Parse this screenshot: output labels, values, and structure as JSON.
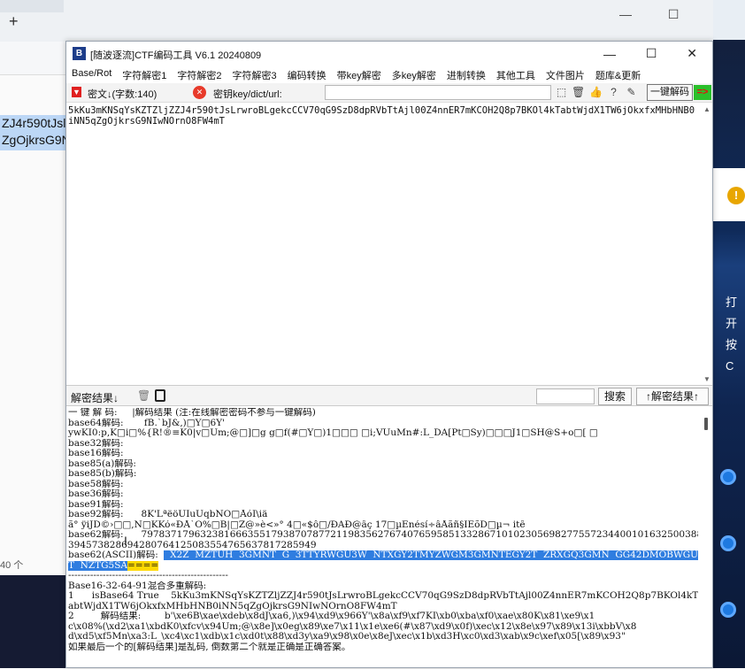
{
  "browser": {
    "new_tab_icon": "+",
    "selected_text_line1": "ZJ4r590tJsl",
    "selected_text_line2": "ZgOjkrsG9N",
    "count_text": "40 个",
    "controls": [
      "—",
      "☐",
      "✕"
    ]
  },
  "side_panel": {
    "warn_icon": "!",
    "text_line1": "打开",
    "text_line2": "按C"
  },
  "window": {
    "icon": "B",
    "title": "[随波逐流]CTF编码工具 V6.1 20240809",
    "minimize": "—",
    "maximize": "☐",
    "close": "✕"
  },
  "menu": [
    "Base/Rot",
    "字符解密1",
    "字符解密2",
    "字符解密3",
    "编码转换",
    "带key解密",
    "多key解密",
    "进制转换",
    "其他工具",
    "文件图片",
    "题库&更新"
  ],
  "toolbar": {
    "ciphertext_label": "密文↓(字数:140)",
    "key_label": "密钥key/dict/url:",
    "key_value": "",
    "one_key_button": "一键解码",
    "go_button": "=>"
  },
  "input": {
    "text": "5kKu3mKNSqYsKZTZljZZJ4r590tJsLrwroBLgekcCCV70qG9SzD8dpRVbTtAjl00Z4nnER7mKCOH2Q8p7BKOl4kTabtWjdX1TW6jOkxfxMHbHNB0iNN5qZgOjkrsG9NIwNOrnO8FW4mT"
  },
  "result_bar": {
    "label": "解密结果↓",
    "search_value": "",
    "search_button": "搜索",
    "export_button": "↑解密结果↑"
  },
  "output_lines": [
    {
      "t": "一 键 解 码:     |解码结果 (注:在线解密密码不参与一键解码)"
    },
    {
      "t": "base64解码:       fB.`bJ&,)□Y□6Y'"
    },
    {
      "t": "ywKI0:p,K□i□%{R!®≡K0|v□Um;@□]□g g□f(#□Y□)1□□□ □i;VUuMn#:L_DA[Pt□Sy)□□□J1□SH@S+o□[ □"
    },
    {
      "t": "base32解码:"
    },
    {
      "t": "base16解码:"
    },
    {
      "t": "base85(a)解码:"
    },
    {
      "t": "base85(b)解码:"
    },
    {
      "t": "base58解码:"
    },
    {
      "t": "base36解码:"
    },
    {
      "t": "base91解码:"
    },
    {
      "t": "base92解码:      8K'LªëöÛIuÜqbNÖ□ÅóÎ\\iä"
    },
    {
      "t": "ã° ÿiJD©›□□,Ñ□KKó«ÐÅ`Ö%□B|□Z@»è<»° 4□«$ô□/ÐAÐ@âç 17□µÉnésí÷âÅãñ§ÎEõD□µ¬ itê"
    },
    {
      "t": "base62解码:      7978371796323816663551793870787721198356276740765958513328671010230569827755723440010163250038824848225956290888739935206503778263002917938893877040698882076598493551370597359283761861436757516359422213719169"
    },
    {
      "t": "394573828694280764125083554765637817285949"
    },
    {
      "t": "base62(ASCII)解码:  ",
      "h": "  X2Z  MZTUH  3GMNT  G  3TTYRWGU3W  NTXGY2TMYZWGM3GMNTEGY2T  ZRXGQ3GMN  GG42DMOBWGU2WMNRWGY4TMZJWGEZ"
    },
    {
      "t": "",
      "h": "T  NZTG5SA",
      "y": "===="
    },
    {
      "t": "---------------------------------------------------"
    },
    {
      "t": "Base16-32-64-91混合多重解码:"
    },
    {
      "t": "1      isBase64 True    5kKu3mKNSqYsKZTZljZZJ4r590tJsLrwroBLgekcCCV70qG9SzD8dpRVbTtAjl00Z4nnER7mKCOH2Q8p7BKOl4kT"
    },
    {
      "t": "abtWjdX1TW6jOkxfxMHbHNB0iNN5qZgOjkrsG9NIwNOrnO8FW4mT"
    },
    {
      "t": "2         解码结果:        b'\\xe6B\\xae\\xdeb\\x8dJ\\xa6,)\\x94\\xd9\\x966Y'\\x8a\\xf9\\xf7KI\\xb0\\xba\\xf0\\xae\\x80K\\x81\\xe9\\x1"
    },
    {
      "t": "c\\x08%(\\xd2\\xa1\\xbdK0\\xfcv\\x94Um;@\\x8e]\\x0eg\\x89\\xe7\\x11\\x1e\\xe6(#\\x87\\xd9\\x0f)\\xec\\x12\\x8e\\x97\\x89\\x13i\\xbbV\\x8"
    },
    {
      "t": "d\\xd5\\xf5Mn\\xa3:L_\\xc4\\xc1\\xdb\\x1c\\xd0t\\x88\\xd3y\\xa9\\x98\\x0e\\x8eJ\\xec\\x1b\\xd3H\\xc0\\xd3\\xab\\x9c\\xef\\x05[\\x89\\x93\""
    },
    {
      "t": "如果最后一个的[解码结果]是乱码, 倒数第二个就是正确是正确答案。"
    }
  ]
}
